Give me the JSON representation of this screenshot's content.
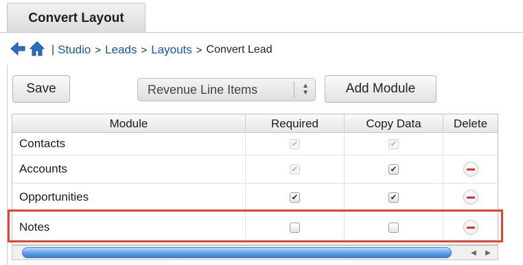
{
  "tab": {
    "label": "Convert Layout"
  },
  "breadcrumb": {
    "separator": "|",
    "items": [
      "Studio",
      "Leads",
      "Layouts"
    ],
    "arrow": ">",
    "current": "Convert Lead"
  },
  "toolbar": {
    "save_label": "Save",
    "module_select": {
      "value": "Revenue Line Items"
    },
    "add_module_label": "Add Module"
  },
  "table": {
    "columns": [
      "Module",
      "Required",
      "Copy Data",
      "Delete"
    ],
    "rows": [
      {
        "module": "Contacts",
        "required": true,
        "required_disabled": true,
        "copy": true,
        "copy_disabled": true,
        "deletable": false
      },
      {
        "module": "Accounts",
        "required": true,
        "required_disabled": true,
        "copy": true,
        "copy_disabled": false,
        "deletable": true
      },
      {
        "module": "Opportunities",
        "required": true,
        "required_disabled": false,
        "copy": true,
        "copy_disabled": false,
        "deletable": true
      },
      {
        "module": "Notes",
        "required": false,
        "required_disabled": false,
        "copy": false,
        "copy_disabled": false,
        "deletable": true
      }
    ]
  },
  "highlight_color": "#e8412c",
  "accent_color": "#1a56a6",
  "icons": {
    "back": "back-arrow-icon",
    "home": "home-icon",
    "delete": "minus-circle-icon"
  }
}
